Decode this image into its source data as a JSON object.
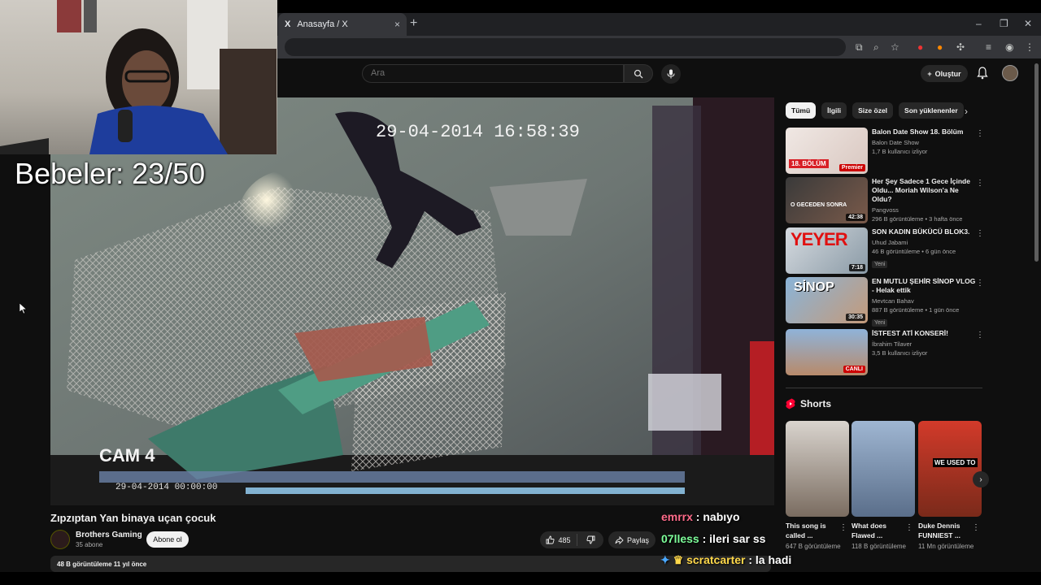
{
  "browser": {
    "tab_title": "Anasayfa / X",
    "tab_logo": "X",
    "close_glyph": "×",
    "new_tab_glyph": "+",
    "window_controls": [
      "–",
      "❐",
      "✕"
    ]
  },
  "webcam": {
    "overlay_text": "Bebeler: 23/50"
  },
  "youtube_header": {
    "search_placeholder": "Ara",
    "create_label": "Oluştur"
  },
  "video": {
    "title": "Zıpzıptan Yan binaya uçan çocuk",
    "channel": "Brothers Gaming",
    "subscribers": "35 abone",
    "subscribe_label": "Abone ol",
    "likes": "485",
    "share_label": "Paylaş",
    "description_meta": "48 B görüntüleme  11 yıl önce",
    "cctv_timestamp": "29-04-2014 16:58:39",
    "cctv_camera": "CAM 4",
    "cctv_bottom_date": "29-04-2014 00:00:00"
  },
  "chat": [
    {
      "user": "emrrx",
      "message": "nabıyo"
    },
    {
      "user": "07lless",
      "message": "ileri sar ss"
    },
    {
      "user": "scratcarter",
      "message": "la hadi"
    }
  ],
  "chips": [
    "Tümü",
    "İlgili",
    "Size özel",
    "Son yüklenenler"
  ],
  "recommendations": [
    {
      "title": "Balon Date Show 18. Bölüm",
      "channel": "Balon Date Show",
      "meta": "1,7 B kullanıcı izliyor",
      "badge": "Premier",
      "thumb_text": "18. BÖLÜM"
    },
    {
      "title": "Her Şey Sadece 1 Gece İçinde Oldu... Moriah Wilson'a Ne Oldu?",
      "channel": "Pangvoss",
      "meta": "296 B görüntüleme • 3 hafta önce",
      "badge": "42:38",
      "thumb_text": "O GECEDEN SONRA"
    },
    {
      "title": "SON KADIN BÜKÜCÜ BLOK3.",
      "channel": "Uhud Jabami",
      "meta": "46 B görüntüleme • 6 gün önce",
      "new": "Yeni",
      "badge": "7:18",
      "thumb_text": "YEYER"
    },
    {
      "title": "EN MUTLU ŞEHİR SİNOP VLOG - Helak ettik",
      "channel": "Mevtcan Bahav",
      "meta": "887 B görüntüleme • 1 gün önce",
      "new": "Yeni",
      "badge": "30:35",
      "thumb_text": "SİNOP"
    },
    {
      "title": "İSTFEST ATİ KONSERİ!",
      "channel": "İbrahim Tilaver",
      "meta": "3,5 B kullanıcı izliyor",
      "badge": "CANLI",
      "thumb_text": ""
    }
  ],
  "shorts": {
    "heading": "Shorts",
    "items": [
      {
        "title": "This song is called ...",
        "views": "647 B görüntüleme"
      },
      {
        "title": "What does Flawed ...",
        "views": "118 B görüntüleme"
      },
      {
        "title": "Duke Dennis FUNNIEST ...",
        "views": "11 Mn görüntüleme",
        "thumb_text": "WE USED TO"
      }
    ]
  },
  "colors": {
    "background": "#0f0f0f",
    "chat_user_1": "#ff6b8a",
    "chat_user_2": "#7dff9a",
    "chat_user_3": "#ffd84a",
    "live_red": "#cc0000"
  }
}
